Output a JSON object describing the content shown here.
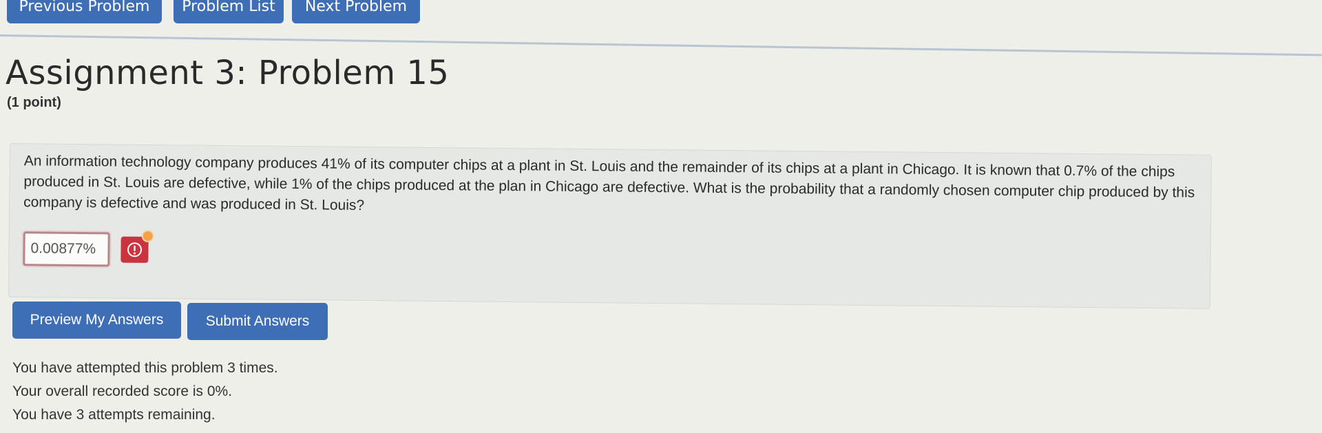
{
  "nav": {
    "previous": "Previous Problem",
    "list": "Problem List",
    "next": "Next Problem"
  },
  "problem": {
    "title": "Assignment 3: Problem 15",
    "points": "(1 point)",
    "text": "An information technology company produces 41% of its computer chips at a plant in St. Louis and the remainder of its chips at a plant in Chicago. It is known that 0.7% of the chips produced in St. Louis are defective, while 1% of the chips produced at the plan in Chicago are defective. What is the probability that a randomly chosen computer chip produced by this company is defective and was produced in St. Louis?",
    "answer_value": "0.00877%",
    "warning_icon": "exclamation-circle-icon"
  },
  "buttons": {
    "preview": "Preview My Answers",
    "submit": "Submit Answers"
  },
  "status": {
    "attempts": "You have attempted this problem 3 times.",
    "score": "Your overall recorded score is 0%.",
    "remaining": "You have 3 attempts remaining."
  },
  "colors": {
    "button_blue": "#3d6eb6",
    "warning_red": "#c9343f",
    "alert_orange": "#f0a34a",
    "input_border": "#b6868a"
  }
}
